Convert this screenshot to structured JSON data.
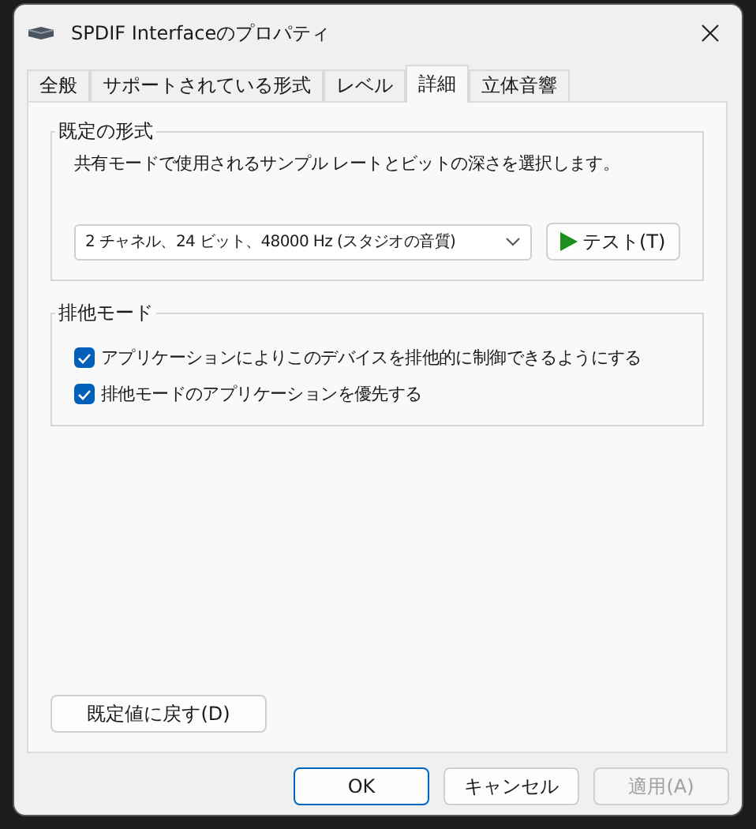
{
  "window": {
    "title": "SPDIF Interfaceのプロパティ"
  },
  "tabs": [
    {
      "label": "全般",
      "selected": false
    },
    {
      "label": "サポートされている形式",
      "selected": false
    },
    {
      "label": "レベル",
      "selected": false
    },
    {
      "label": "詳細",
      "selected": true
    },
    {
      "label": "立体音響",
      "selected": false
    }
  ],
  "default_format": {
    "title": "既定の形式",
    "description": "共有モードで使用されるサンプル レートとビットの深さを選択します。",
    "format_select": {
      "value": "2 チャネル、24 ビット、48000 Hz (スタジオの音質)"
    },
    "test_button": "テスト(T)"
  },
  "exclusive_mode": {
    "title": "排他モード",
    "options": [
      {
        "label": "アプリケーションによりこのデバイスを排他的に制御できるようにする",
        "checked": true
      },
      {
        "label": "排他モードのアプリケーションを優先する",
        "checked": true
      }
    ]
  },
  "restore_button": "既定値に戻す(D)",
  "buttons": [
    {
      "label": "OK",
      "kind": "default",
      "disabled": false
    },
    {
      "label": "キャンセル",
      "kind": "normal",
      "disabled": false
    },
    {
      "label": "適用(A)",
      "kind": "normal",
      "disabled": true
    }
  ]
}
